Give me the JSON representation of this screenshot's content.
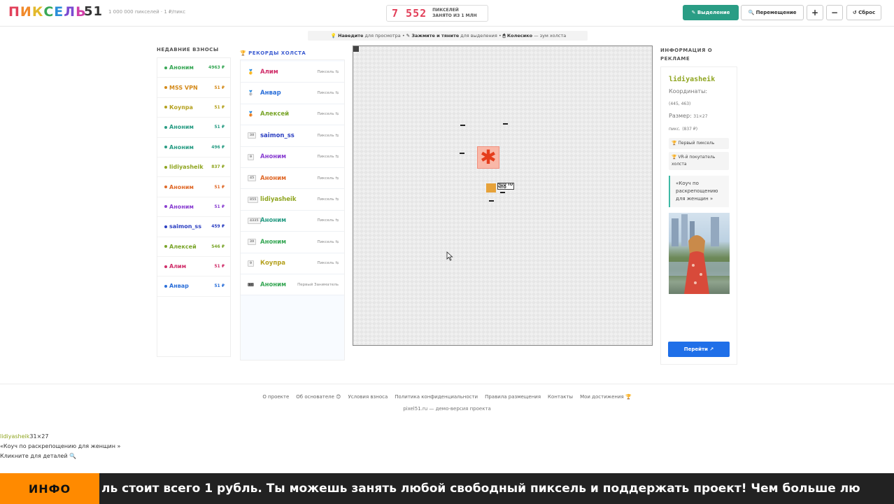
{
  "header": {
    "logo_letters": [
      {
        "ch": "П",
        "color": "#e2405a"
      },
      {
        "ch": "И",
        "color": "#f18a2b"
      },
      {
        "ch": "К",
        "color": "#e3b92c"
      },
      {
        "ch": "С",
        "color": "#39a857"
      },
      {
        "ch": "Е",
        "color": "#2b8fd9"
      },
      {
        "ch": "Л",
        "color": "#7b4bd1"
      },
      {
        "ch": "Ь",
        "color": "#d03fa8"
      }
    ],
    "logo_number": "51",
    "logo_sub": "1 000 000 пикселей · 1 ₽/пикс",
    "counter_value": "7 552",
    "counter_label_1": "ПИКСЕЛЕЙ",
    "counter_label_2": "ЗАНЯТО ИЗ 1 МЛН",
    "btn_select": "✎ Выделение",
    "btn_move": "🔍 Перемещение",
    "btn_zoom_in": "+",
    "btn_zoom_out": "−",
    "btn_reset": "↺ Сброс"
  },
  "hint": {
    "p1_b": "💡 Наведите",
    "p1": "для просмотра •",
    "p2_b": "✎ Зажмите и тяните",
    "p2": "для выделения •",
    "p3_b": "🖱 Колесико",
    "p3": "— зум холста"
  },
  "recent": {
    "title": "НЕДАВНИЕ ВЗНОСЫ",
    "items": [
      {
        "name": "Аноним",
        "value": "4963 ₽",
        "color": "#39a857"
      },
      {
        "name": "MSS VPN",
        "value": "51 ₽",
        "color": "#d48a1a"
      },
      {
        "name": "Коупра",
        "value": "51 ₽",
        "color": "#b5a11f"
      },
      {
        "name": "Аноним",
        "value": "51 ₽",
        "color": "#2a9d85"
      },
      {
        "name": "Аноним",
        "value": "496 ₽",
        "color": "#2a9d85"
      },
      {
        "name": "lidiyasheik",
        "value": "837 ₽",
        "color": "#8fa520"
      },
      {
        "name": "Аноним",
        "value": "51 ₽",
        "color": "#e06a2a"
      },
      {
        "name": "Аноним",
        "value": "51 ₽",
        "color": "#8a3fd1"
      },
      {
        "name": "saimon_ss",
        "value": "459 ₽",
        "color": "#2b3fc2"
      },
      {
        "name": "Алексей",
        "value": "546 ₽",
        "color": "#7aa52a"
      },
      {
        "name": "Алим",
        "value": "51 ₽",
        "color": "#d02f6a"
      },
      {
        "name": "Анвар",
        "value": "51 ₽",
        "color": "#2b6fd9"
      }
    ]
  },
  "records": {
    "title": "🏆 РЕКОРДЫ ХОЛСТА",
    "items": [
      {
        "rank": "🥇",
        "name": "Алим",
        "label": "Пиксель ⇆",
        "color": "#d02f6a"
      },
      {
        "rank": "🥈",
        "name": "Анвар",
        "label": "Пиксель ⇆",
        "color": "#2b6fd9"
      },
      {
        "rank": "🥉",
        "name": "Алексей",
        "label": "Пиксель ⇆",
        "color": "#7aa52a"
      },
      {
        "rank": "38",
        "name": "saimon_ss",
        "label": "Пиксель ⇆",
        "color": "#2b3fc2"
      },
      {
        "rank": "9",
        "name": "Аноним",
        "label": "Пиксель ⇆",
        "color": "#8a3fd1"
      },
      {
        "rank": "45",
        "name": "Аноним",
        "label": "Пиксель ⇆",
        "color": "#e06a2a"
      },
      {
        "rank": "855",
        "name": "lidiyasheik",
        "label": "Пиксель ⇆",
        "color": "#8fa520"
      },
      {
        "rank": "4335",
        "name": "Аноним",
        "label": "Пиксель ⇆",
        "color": "#2a9d85"
      },
      {
        "rank": "39",
        "name": "Аноним",
        "label": "Пиксель ⇆",
        "color": "#39a857"
      },
      {
        "rank": "9",
        "name": "Коупра",
        "label": "Пиксель ⇆",
        "color": "#b5a11f"
      },
      {
        "rank": "🎟",
        "name": "Аноним",
        "label": "Первый Заниматель",
        "color": "#39a857"
      }
    ]
  },
  "canvas": {
    "art_glyph": "✱",
    "art_text": "ЧТО ТО ЧТО"
  },
  "info": {
    "title": "ИНФОРМАЦИЯ О РЕКЛАМЕ",
    "name": "lidiyasheik",
    "coords_label": "Координаты:",
    "coords_value": "(445, 463)",
    "size_label": "Размер:",
    "size_value": "31×27",
    "size_tail": "пикс.",
    "price": "(837 ₽)",
    "badge_1": "🏆 Первый пиксель",
    "badge_2": "🏆 VR-й покупатель холста",
    "quote": "«Коуч по раскрепощению для женщин »",
    "go_label": "Перейти ↗"
  },
  "footer": {
    "links": [
      "О проекте",
      "Об основателе 😊",
      "Условия взноса",
      "Политика конфиденциальности",
      "Правила размещения",
      "Контакты",
      "Мои достижения 🏆"
    ],
    "note": "pixel51.ru — демо-версия проекта"
  },
  "tooltip": {
    "name": "lidiyasheik",
    "size": "31×27",
    "text": "«Коуч по раскрепощению для женщин »",
    "hint": "Кликните для деталей 🔍"
  },
  "ticker": {
    "label": "ИНФО",
    "text": "ль стоит всего 1 рубль. Ты можешь занять любой свободный пиксель и поддержать проект! Чем больше лю"
  }
}
